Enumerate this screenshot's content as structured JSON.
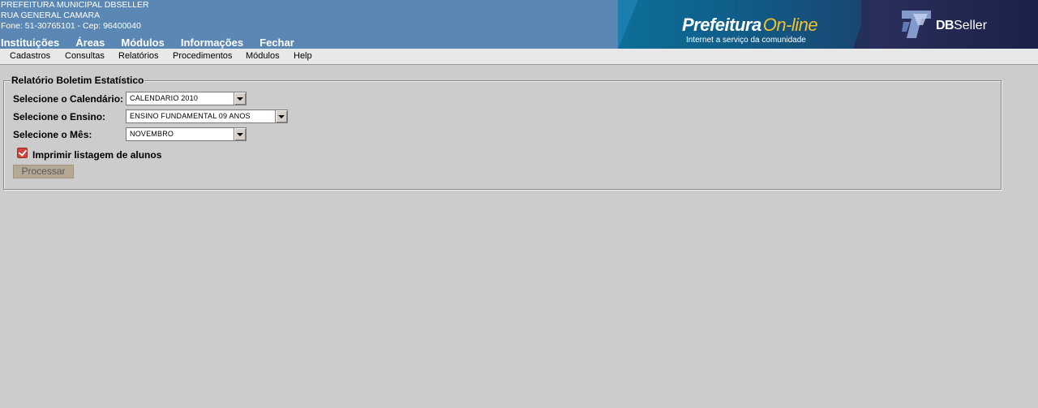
{
  "institution": {
    "name": "PREFEITURA MUNICIPAL DBSELLER",
    "address": "RUA GENERAL CAMARA",
    "contact": "Fone: 51-30765101  -  Cep: 96400040"
  },
  "top_nav": [
    "Instituições",
    "Áreas",
    "Módulos",
    "Informações",
    "Fechar"
  ],
  "banner": {
    "logo_word1": "Prefeitura",
    "logo_word2": "On-line",
    "tagline": "Internet a serviço da comunidade",
    "company_db": "DB",
    "company_rest": "Seller",
    "colors": {
      "cyan": "#0d6f99",
      "dark_navy": "#23305a",
      "accent_yellow": "#f2c12e"
    }
  },
  "menu": [
    "Cadastros",
    "Consultas",
    "Relatórios",
    "Procedimentos",
    "Módulos",
    "Help"
  ],
  "form": {
    "title": "Relatório Boletim Estatístico",
    "calendar_label": "Selecione o Calendário:",
    "calendar_value": "CALENDARIO 2010",
    "ensino_label": "Selecione o Ensino:",
    "ensino_value": "ENSINO FUNDAMENTAL 09 ANOS",
    "mes_label": "Selecione o Mês:",
    "mes_value": "NOVEMBRO",
    "checkbox_label": "Imprimir listagem de alunos",
    "checkbox_checked": true,
    "submit_label": "Processar"
  }
}
